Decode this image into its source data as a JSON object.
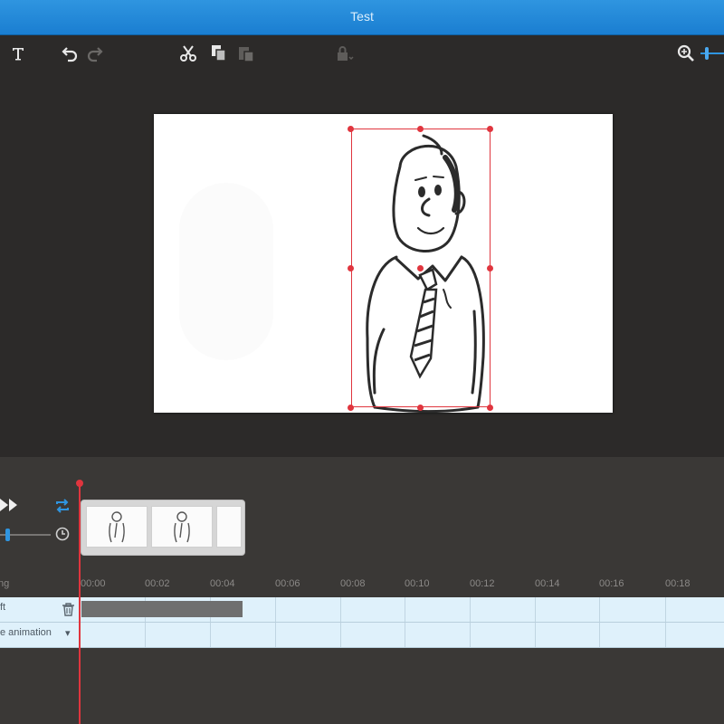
{
  "window": {
    "title": "Test"
  },
  "toolbar": {
    "items": [
      {
        "name": "text-tool",
        "icon": "text-icon"
      },
      {
        "name": "undo",
        "icon": "undo-icon"
      },
      {
        "name": "redo",
        "icon": "redo-icon"
      },
      {
        "name": "cut",
        "icon": "scissors-icon"
      },
      {
        "name": "copy",
        "icon": "copy-icon"
      },
      {
        "name": "paste",
        "icon": "paste-icon"
      },
      {
        "name": "lock",
        "icon": "lock-icon"
      },
      {
        "name": "zoom",
        "icon": "magnifier-icon"
      }
    ]
  },
  "timeline": {
    "ruler": {
      "label": "ng",
      "ticks": [
        "00:00",
        "00:02",
        "00:04",
        "00:06",
        "00:08",
        "00:10",
        "00:12",
        "00:14",
        "00:16",
        "00:18"
      ]
    },
    "tracks": [
      {
        "label": "ft"
      },
      {
        "label": "e animation",
        "dropdown": "▾"
      }
    ]
  },
  "colors": {
    "titlebar": "#1a7ed1",
    "accent_red": "#e0353e",
    "track_bg": "#dff1fb",
    "panel_bg": "#2c2a29"
  }
}
